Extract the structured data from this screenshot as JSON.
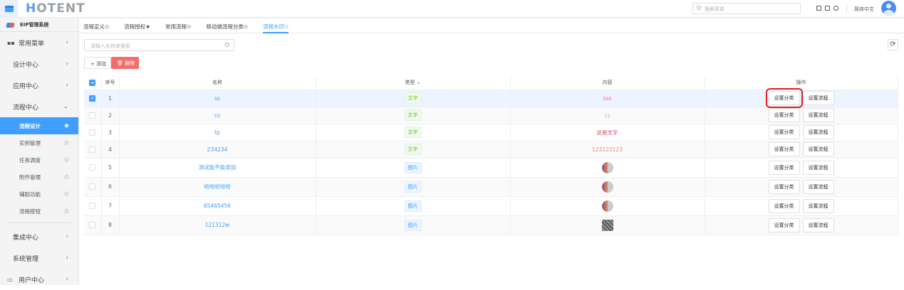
{
  "header": {
    "logo": "HOTENT",
    "search_placeholder": "搜索菜单",
    "language": "简体中文"
  },
  "sidebar": {
    "system": "EIP管理系统",
    "items": [
      {
        "label": "常用菜单"
      },
      {
        "label": "设计中心"
      },
      {
        "label": "应用中心"
      },
      {
        "label": "流程中心"
      }
    ],
    "sub_items": [
      {
        "label": "流程设计",
        "active": true
      },
      {
        "label": "实例管理"
      },
      {
        "label": "任务调度"
      },
      {
        "label": "附件管理"
      },
      {
        "label": "辅助功能"
      },
      {
        "label": "流程按钮"
      }
    ],
    "bottom_items": [
      {
        "label": "集成中心"
      },
      {
        "label": "系统管理"
      },
      {
        "label": "用户中心"
      }
    ]
  },
  "tabs": [
    {
      "label": "流程定义✩"
    },
    {
      "label": "流程授权★"
    },
    {
      "label": "常用流程✩"
    },
    {
      "label": "移动端流程分类✩"
    },
    {
      "label": "流程水印✩",
      "active": true
    }
  ],
  "toolbar": {
    "search_placeholder": "请输入名称来搜索",
    "add": "+ 添加",
    "delete": "删除"
  },
  "table": {
    "headers": {
      "index": "序号",
      "name": "名称",
      "type": "类型",
      "content": "内容",
      "actions": "操作"
    },
    "action_set_category": "设置分类",
    "action_set_flow": "设置流程",
    "rows": [
      {
        "index": "1",
        "name": "ss",
        "type": "文字",
        "content": "sss",
        "color": "#f56c6c",
        "selected": true
      },
      {
        "index": "2",
        "name": "cs",
        "type": "文字",
        "content": "cs",
        "color": "#85e06b"
      },
      {
        "index": "3",
        "name": "tp",
        "type": "文字",
        "content": "这是文字",
        "color": "#d0445a"
      },
      {
        "index": "4",
        "name": "234234",
        "type": "文字",
        "content": "123123123",
        "color": "#f7845e"
      },
      {
        "index": "5",
        "name": "测试能不能添加",
        "type": "图片",
        "content": ""
      },
      {
        "index": "6",
        "name": "哈哈哈哈哈",
        "type": "图片",
        "content": ""
      },
      {
        "index": "7",
        "name": "65465456",
        "type": "图片",
        "content": ""
      },
      {
        "index": "8",
        "name": "121312w",
        "type": "图片",
        "content": "",
        "qr": true
      }
    ]
  }
}
